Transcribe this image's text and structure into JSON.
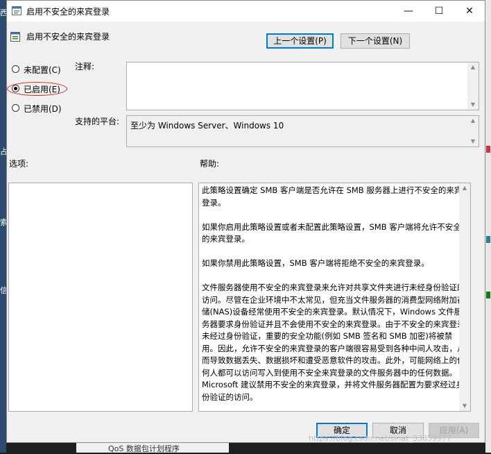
{
  "window": {
    "title": "启用不安全的来宾登录",
    "min_glyph": "—",
    "max_glyph": "☐",
    "close_glyph": "✕"
  },
  "header": {
    "policy_title": "启用不安全的来宾登录",
    "prev_setting": "上一个设置(P)",
    "next_setting": "下一个设置(N)"
  },
  "state": {
    "options": [
      {
        "label": "未配置(C)",
        "selected": false
      },
      {
        "label": "已启用(E)",
        "selected": true
      },
      {
        "label": "已禁用(D)",
        "selected": false
      }
    ]
  },
  "comment": {
    "label": "注释:",
    "value": ""
  },
  "platform": {
    "label": "支持的平台:",
    "value": "至少为 Windows Server、Windows 10"
  },
  "options_section": {
    "label": "选项:"
  },
  "help_section": {
    "label": "帮助:",
    "paragraphs": [
      "此策略设置确定 SMB 客户端是否允许在 SMB 服务器上进行不安全的来宾登录。",
      "如果你启用此策略设置或者未配置此策略设置，SMB 客户端将允许不安全的来宾登录。",
      "如果你禁用此策略设置，SMB 客户端将拒绝不安全的来宾登录。",
      "文件服务器使用不安全的来宾登录来允许对共享文件夹进行未经身份验证的访问。尽管在企业环境中不太常见，但充当文件服务器的消费型网络附加存储(NAS)设备经常使用不安全的来宾登录。默认情况下，Windows 文件服务器要求身份验证并且不会使用不安全的来宾登录。由于不安全的来宾登录未经过身份验证，重要的安全功能(例如 SMB 签名和 SMB 加密)将被禁用。因此，允许不安全的来宾登录的客户端很容易受到各种中间人攻击，从而导致数据丢失、数据损坏和遭受恶意软件的攻击。此外，可能网络上的任何人都可以访问写入到使用不安全来宾登录的文件服务器中的任何数据。Microsoft 建议禁用不安全的来宾登录，并将文件服务器配置为要求经过身份验证的访问。"
    ]
  },
  "footer": {
    "ok": "确定",
    "cancel": "取消",
    "apply": "应用(A)"
  },
  "background": {
    "behind_text": "QoS 数据包计划程序",
    "watermark": "https://blog.csdn.net/sinat_33859977",
    "left_fragments": [
      "西",
      "占",
      "索",
      "信"
    ]
  },
  "colors": {
    "accent": "#0078d7",
    "annotation": "#e02020",
    "dialog_bg": "#f0f0f0"
  }
}
